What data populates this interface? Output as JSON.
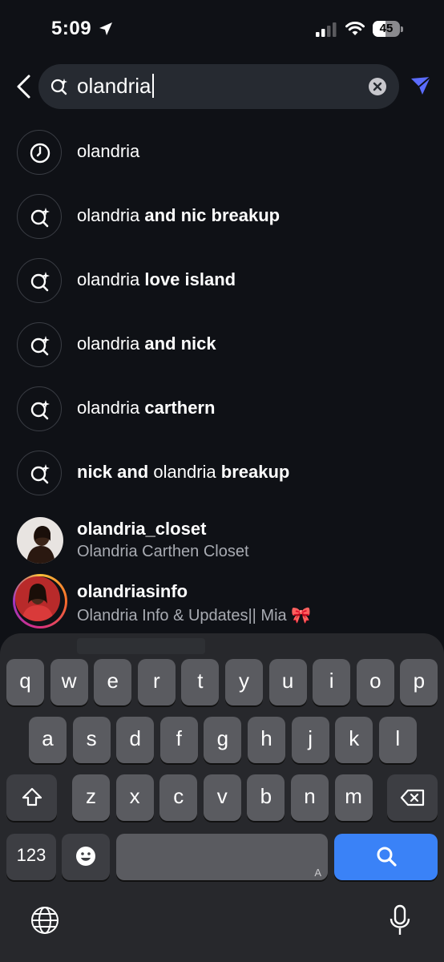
{
  "status_bar": {
    "time": "5:09",
    "battery": "45"
  },
  "search": {
    "query": "olandria"
  },
  "suggestions": [
    {
      "icon": "clock-icon",
      "parts": [
        {
          "text": "olandria",
          "bold": false
        }
      ]
    },
    {
      "icon": "search-sparkle-icon",
      "parts": [
        {
          "text": "olandria ",
          "bold": false
        },
        {
          "text": "and nic breakup",
          "bold": true
        }
      ]
    },
    {
      "icon": "search-sparkle-icon",
      "parts": [
        {
          "text": "olandria ",
          "bold": false
        },
        {
          "text": "love island",
          "bold": true
        }
      ]
    },
    {
      "icon": "search-sparkle-icon",
      "parts": [
        {
          "text": "olandria ",
          "bold": false
        },
        {
          "text": "and nick",
          "bold": true
        }
      ]
    },
    {
      "icon": "search-sparkle-icon",
      "parts": [
        {
          "text": "olandria ",
          "bold": false
        },
        {
          "text": "carthern",
          "bold": true
        }
      ]
    },
    {
      "icon": "search-sparkle-icon",
      "parts": [
        {
          "text": "nick and ",
          "bold": true
        },
        {
          "text": "olandria ",
          "bold": false
        },
        {
          "text": "breakup",
          "bold": true
        }
      ]
    }
  ],
  "accounts": [
    {
      "username": "olandria_closet",
      "name": "Olandria Carthen Closet",
      "story_ring": false
    },
    {
      "username": "olandriasinfo",
      "name": "Olandria Info & Updates|| Mia 🎀",
      "story_ring": true
    }
  ],
  "keyboard": {
    "row1": [
      "q",
      "w",
      "e",
      "r",
      "t",
      "y",
      "u",
      "i",
      "o",
      "p"
    ],
    "row2": [
      "a",
      "s",
      "d",
      "f",
      "g",
      "h",
      "j",
      "k",
      "l"
    ],
    "row3": [
      "z",
      "x",
      "c",
      "v",
      "b",
      "n",
      "m"
    ],
    "numbers_label": "123",
    "space_mark": "A"
  },
  "colors": {
    "background": "#0f1116",
    "search_key": "#3a82f7",
    "filter_icon": "#5b6cff"
  }
}
